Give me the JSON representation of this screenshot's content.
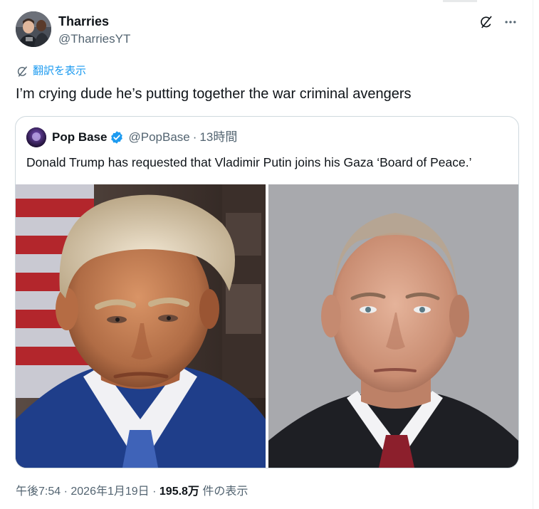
{
  "author": {
    "display_name": "Tharries",
    "handle": "@TharriesYT"
  },
  "translate_label": "翻訳を表示",
  "tweet_text": "I’m crying dude he’s putting together the war criminal avengers",
  "quote": {
    "display_name": "Pop Base",
    "handle": "@PopBase",
    "separator": "·",
    "time": "13時間",
    "text": "Donald Trump has requested that Vladimir Putin joins his Gaza ‘Board of Peace.’"
  },
  "meta": {
    "time": "午後7:54",
    "sep1": " · ",
    "date": "2026年1月19日",
    "sep2": " · ",
    "views_count": "195.8万",
    "views_label": " 件の表示"
  },
  "colors": {
    "accent": "#1d9bf0",
    "text": "#0f1419",
    "secondary": "#536471",
    "border": "#cfd9de"
  },
  "icons": {
    "grok": "grok-icon",
    "more": "more-icon",
    "translate": "translate-icon",
    "verified": "verified-badge-icon"
  }
}
